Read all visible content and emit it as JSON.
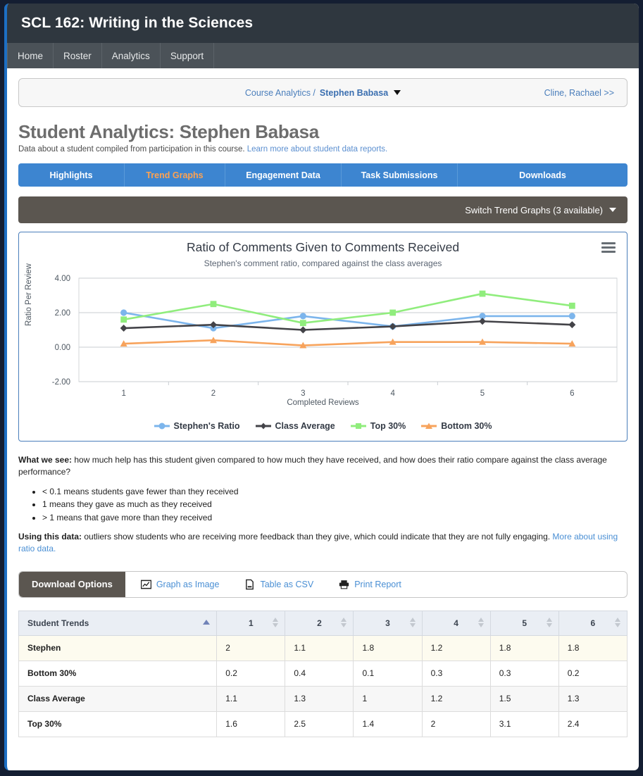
{
  "header": {
    "site_title": "SCL 162: Writing in the Sciences"
  },
  "nav": {
    "items": [
      "Home",
      "Roster",
      "Analytics",
      "Support"
    ]
  },
  "breadcrumb": {
    "parent": "Course Analytics /",
    "current": "Stephen Babasa",
    "next": "Cline, Rachael >>"
  },
  "page": {
    "title": "Student Analytics: Stephen Babasa",
    "subtitle": "Data about a student compiled from participation in this course.",
    "subtitle_link": "Learn more about student data reports."
  },
  "tabs": {
    "items": [
      "Highlights",
      "Trend Graphs",
      "Engagement Data",
      "Task Submissions",
      "Downloads"
    ],
    "active_index": 1
  },
  "switch_bar": {
    "label": "Switch Trend Graphs (3 available)"
  },
  "chart_data": {
    "type": "line",
    "title": "Ratio of Comments Given to Comments Received",
    "subtitle": "Stephen's comment ratio, compared against the class averages",
    "xlabel": "Completed Reviews",
    "ylabel": "Ratio Per Review",
    "categories": [
      "1",
      "2",
      "3",
      "4",
      "5",
      "6"
    ],
    "ylim": [
      -2.0,
      4.0
    ],
    "yticks": [
      "4.00",
      "2.00",
      "0.00",
      "-2.00"
    ],
    "grid": true,
    "legend_position": "bottom",
    "series": [
      {
        "name": "Stephen's Ratio",
        "values": [
          2,
          1.1,
          1.8,
          1.2,
          1.8,
          1.8
        ],
        "color": "#7cb5ec",
        "marker": "circle"
      },
      {
        "name": "Class Average",
        "values": [
          1.1,
          1.3,
          1,
          1.2,
          1.5,
          1.3
        ],
        "color": "#434348",
        "marker": "diamond"
      },
      {
        "name": "Top 30%",
        "values": [
          1.6,
          2.5,
          1.4,
          2,
          3.1,
          2.4
        ],
        "color": "#90ed7d",
        "marker": "square"
      },
      {
        "name": "Bottom 30%",
        "values": [
          0.2,
          0.4,
          0.1,
          0.3,
          0.3,
          0.2
        ],
        "color": "#f7a35c",
        "marker": "triangle"
      }
    ]
  },
  "prose": {
    "what_we_see_label": "What we see:",
    "what_we_see_text": " how much help has this student given compared to how much they have received, and how does their ratio compare against the class average performance?",
    "bullets": [
      "< 0.1 means students gave fewer than they received",
      "1 means they gave as much as they received",
      "> 1 means that gave more than they received"
    ],
    "using_label": "Using this data:",
    "using_text": " outliers show students who are receiving more feedback than they give, which could indicate that they are not fully engaging. ",
    "using_link": "More about using ratio data."
  },
  "downloads": {
    "active_label": "Download Options",
    "items": [
      {
        "label": "Graph as Image",
        "icon": "chart-image-icon"
      },
      {
        "label": "Table as CSV",
        "icon": "csv-file-icon"
      },
      {
        "label": "Print Report",
        "icon": "printer-icon"
      }
    ]
  },
  "table": {
    "headers": [
      "Student Trends",
      "1",
      "2",
      "3",
      "4",
      "5",
      "6"
    ],
    "rows": [
      {
        "label": "Stephen",
        "values": [
          "2",
          "1.1",
          "1.8",
          "1.2",
          "1.8",
          "1.8"
        ],
        "style": "hl"
      },
      {
        "label": "Bottom 30%",
        "values": [
          "0.2",
          "0.4",
          "0.1",
          "0.3",
          "0.3",
          "0.2"
        ],
        "style": ""
      },
      {
        "label": "Class Average",
        "values": [
          "1.1",
          "1.3",
          "1",
          "1.2",
          "1.5",
          "1.3"
        ],
        "style": "alt"
      },
      {
        "label": "Top 30%",
        "values": [
          "1.6",
          "2.5",
          "1.4",
          "2",
          "3.1",
          "2.4"
        ],
        "style": ""
      }
    ]
  },
  "colors": {
    "accent_blue": "#3d85d0",
    "active_tab_orange": "#ffa250",
    "header_dark": "#2f373f",
    "frame_navy": "#141e32"
  }
}
